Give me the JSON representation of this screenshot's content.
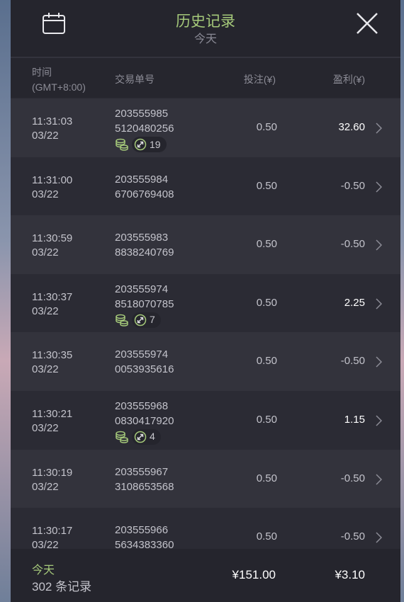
{
  "header": {
    "title": "历史记录",
    "subtitle": "今天",
    "calendar_icon": "calendar-icon",
    "close_icon": "close-icon"
  },
  "columns": {
    "time": "时间",
    "timezone": "(GMT+8:00)",
    "order": "交易单号",
    "bet": "投注(¥)",
    "profit": "盈利(¥)"
  },
  "rows": [
    {
      "time": "11:31:03",
      "date": "03/22",
      "order1": "203555985",
      "order2": "5120480256",
      "bet": "0.50",
      "profit": "32.60",
      "spins": "19"
    },
    {
      "time": "11:31:00",
      "date": "03/22",
      "order1": "203555984",
      "order2": "6706769408",
      "bet": "0.50",
      "profit": "-0.50",
      "spins": null
    },
    {
      "time": "11:30:59",
      "date": "03/22",
      "order1": "203555983",
      "order2": "8838240769",
      "bet": "0.50",
      "profit": "-0.50",
      "spins": null
    },
    {
      "time": "11:30:37",
      "date": "03/22",
      "order1": "203555974",
      "order2": "8518070785",
      "bet": "0.50",
      "profit": "2.25",
      "spins": "7"
    },
    {
      "time": "11:30:35",
      "date": "03/22",
      "order1": "203555974",
      "order2": "0053935616",
      "bet": "0.50",
      "profit": "-0.50",
      "spins": null
    },
    {
      "time": "11:30:21",
      "date": "03/22",
      "order1": "203555968",
      "order2": "0830417920",
      "bet": "0.50",
      "profit": "1.15",
      "spins": "4"
    },
    {
      "time": "11:30:19",
      "date": "03/22",
      "order1": "203555967",
      "order2": "3108653568",
      "bet": "0.50",
      "profit": "-0.50",
      "spins": null
    },
    {
      "time": "11:30:17",
      "date": "03/22",
      "order1": "203555966",
      "order2": "5634383360",
      "bet": "0.50",
      "profit": "-0.50",
      "spins": null
    }
  ],
  "footer": {
    "label": "今天",
    "count": "302 条记录",
    "total_bet": "¥151.00",
    "total_profit": "¥3.10"
  },
  "colors": {
    "accent_green": "#a5c97a",
    "panel_bg": "#2a2a33",
    "row_light": "#33333c",
    "row_dark": "#2b2b34"
  }
}
